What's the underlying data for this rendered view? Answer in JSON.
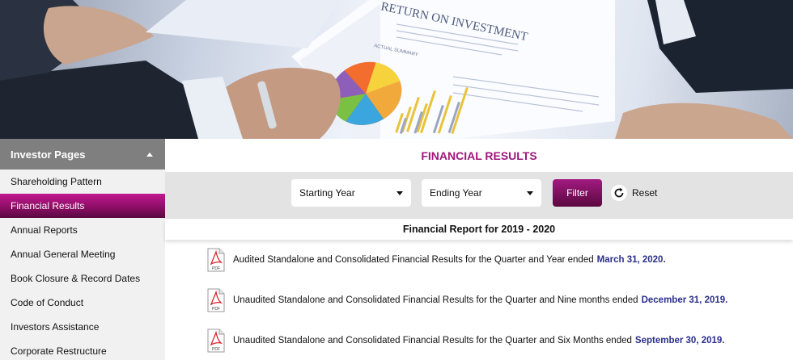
{
  "hero": {
    "document_heading": "RETURN ON INVESTMENT",
    "document_subheading": "ACTUAL SUMMARY"
  },
  "sidebar": {
    "title": "Investor Pages",
    "items": [
      {
        "label": "Shareholding Pattern"
      },
      {
        "label": "Financial Results"
      },
      {
        "label": "Annual Reports"
      },
      {
        "label": "Annual General Meeting"
      },
      {
        "label": "Book Closure & Record Dates"
      },
      {
        "label": "Code of Conduct"
      },
      {
        "label": "Investors Assistance"
      },
      {
        "label": "Corporate Restructure"
      }
    ]
  },
  "main": {
    "title": "FINANCIAL RESULTS",
    "filters": {
      "starting_year": "Starting Year",
      "ending_year": "Ending Year",
      "filter_label": "Filter",
      "reset_label": "Reset"
    },
    "report_heading": "Financial Report for 2019 - 2020",
    "reports": [
      {
        "text": "Audited Standalone and Consolidated Financial Results for the Quarter and Year ended",
        "date": "March 31, 2020."
      },
      {
        "text": "Unaudited Standalone and Consolidated Financial Results for the Quarter and Nine months ended",
        "date": "December 31, 2019."
      },
      {
        "text": "Unaudited Standalone and Consolidated Financial Results for the Quarter and Six Months ended",
        "date": "September 30, 2019."
      }
    ],
    "pdf_icon_label": "PDF"
  },
  "colors": {
    "accent": "#a0167a",
    "active_item": "#8d0f66",
    "date_link": "#2a2f8a",
    "sidebar_header": "#7f7f7f"
  },
  "icons": {
    "sidebar_toggle": "caret-up-icon",
    "select_arrow": "caret-down-icon",
    "reset": "refresh-icon",
    "document": "pdf-icon"
  }
}
